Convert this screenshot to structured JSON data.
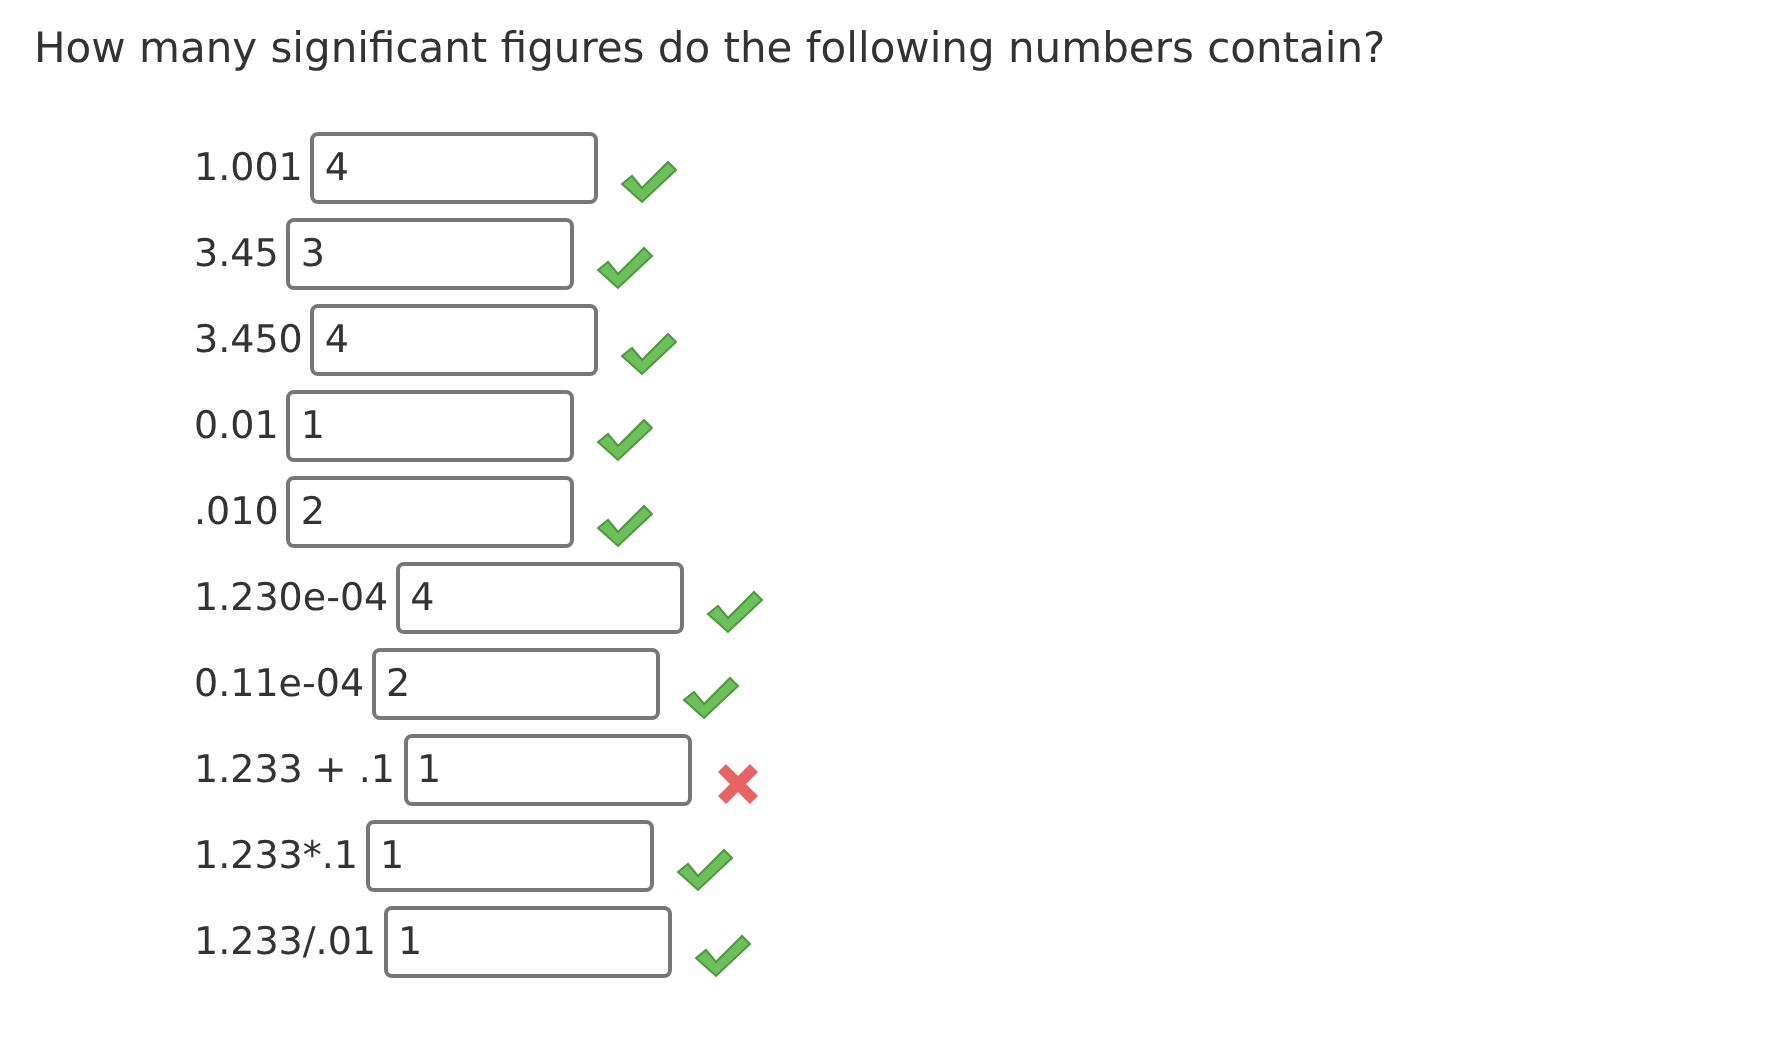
{
  "question": "How many significant figures do the following numbers contain?",
  "items": [
    {
      "number": "1.001",
      "answer": "4",
      "correct": true
    },
    {
      "number": "3.45",
      "answer": "3",
      "correct": true
    },
    {
      "number": "3.450",
      "answer": "4",
      "correct": true
    },
    {
      "number": "0.01",
      "answer": "1",
      "correct": true
    },
    {
      "number": ".010",
      "answer": "2",
      "correct": true
    },
    {
      "number": "1.230e-04",
      "answer": "4",
      "correct": true
    },
    {
      "number": "0.11e-04",
      "answer": "2",
      "correct": true
    },
    {
      "number": "1.233 + .1",
      "answer": "1",
      "correct": false
    },
    {
      "number": "1.233*.1",
      "answer": "1",
      "correct": true
    },
    {
      "number": "1.233/.01",
      "answer": "1",
      "correct": true
    }
  ]
}
